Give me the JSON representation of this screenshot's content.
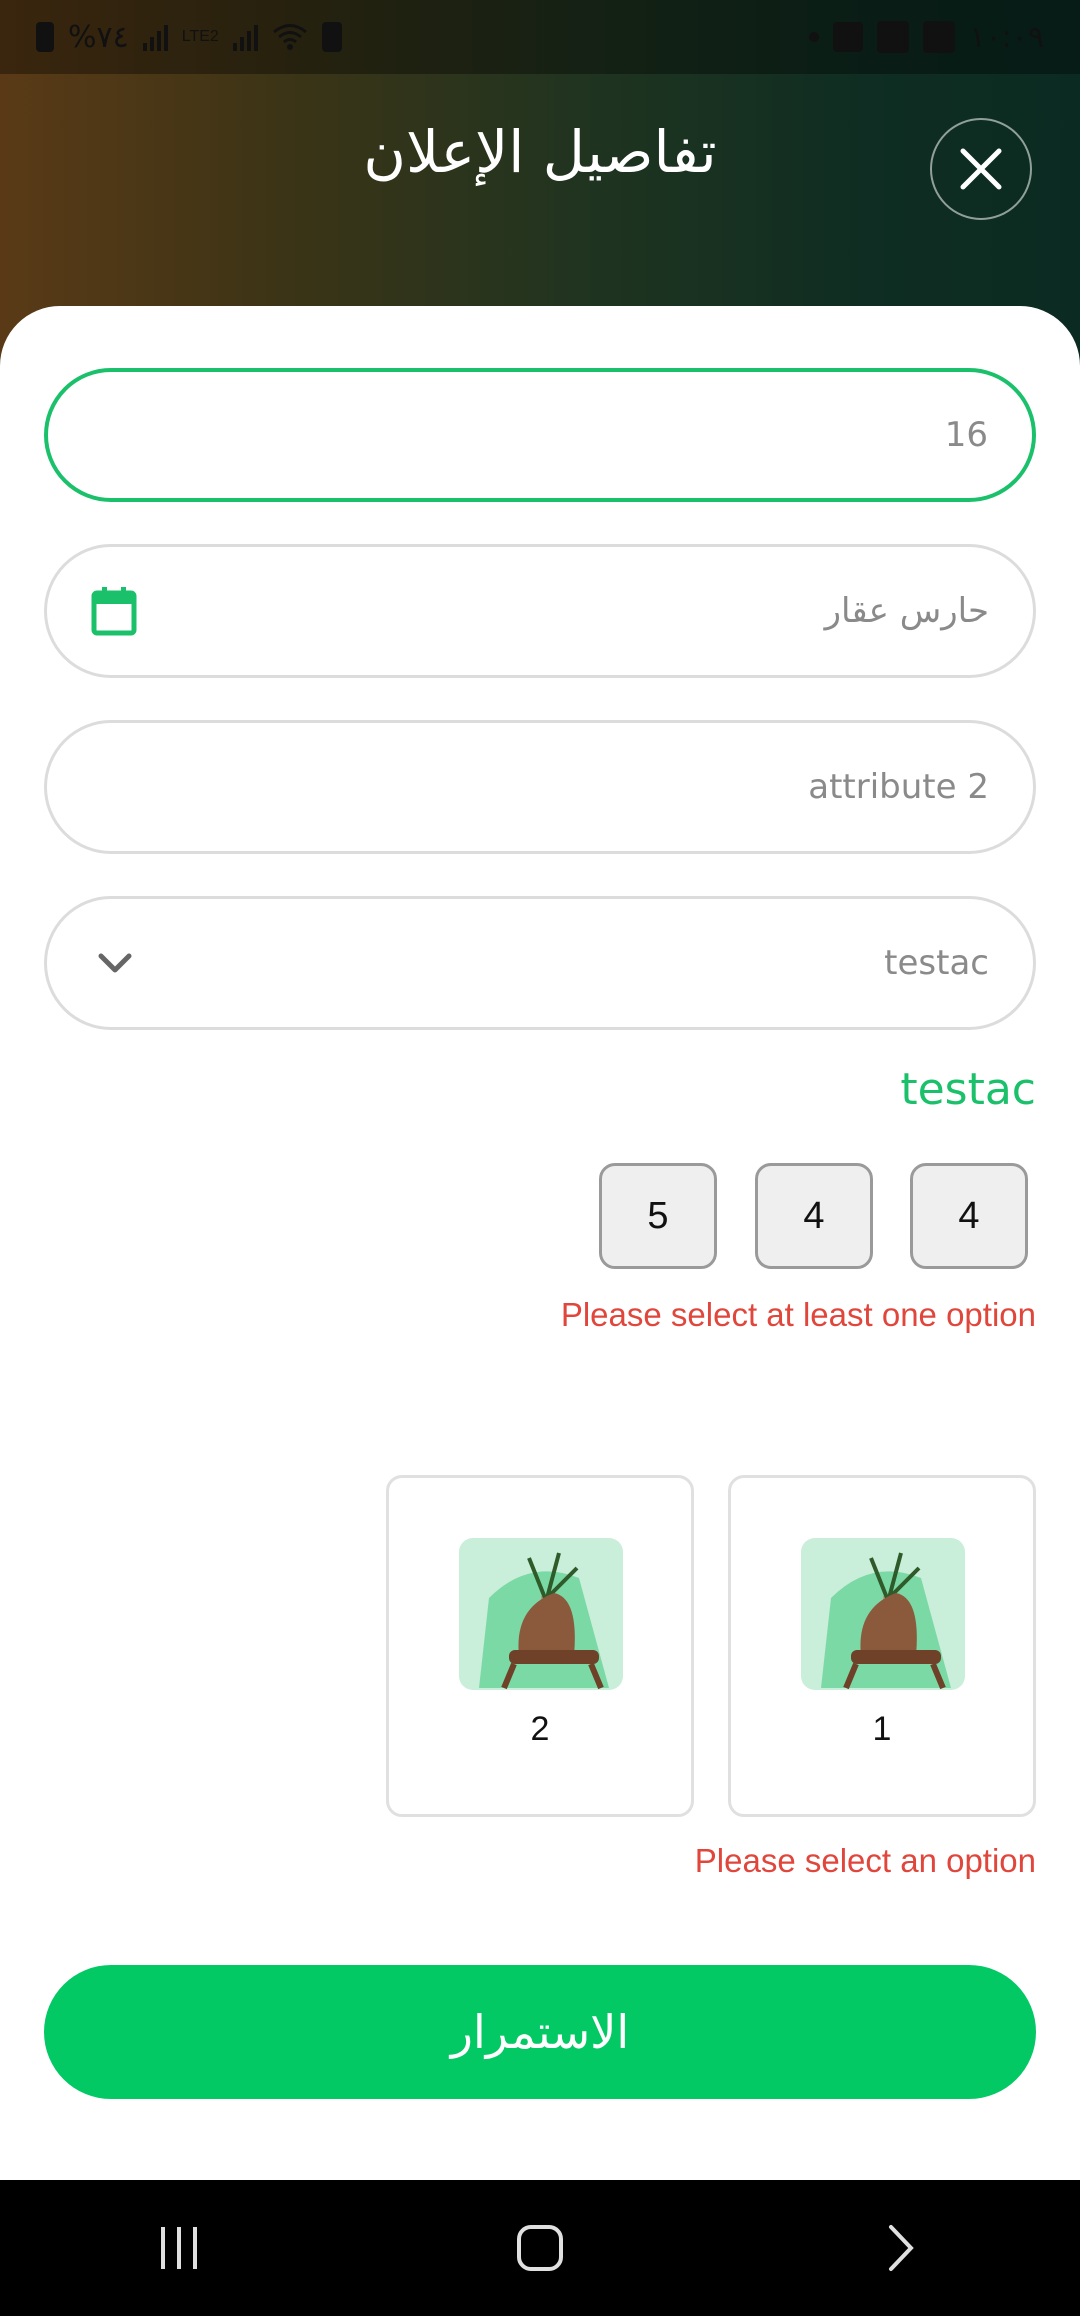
{
  "status_bar": {
    "battery_text": "%٧٤",
    "network_label": "LTE2",
    "time": "١٠:٠٩"
  },
  "header": {
    "title": "تفاصيل الإعلان"
  },
  "form": {
    "field1_value": "16",
    "field2_placeholder": "حارس عقار",
    "field3_placeholder": "attribute 2",
    "field4_selected": "testac"
  },
  "multi_select": {
    "label": "testac",
    "options": [
      "4",
      "4",
      "5"
    ],
    "error": "Please select at least one option"
  },
  "image_select": {
    "options": [
      "1",
      "2"
    ],
    "error": "Please select an option"
  },
  "continue_label": "الاستمرار",
  "colors": {
    "accent": "#02c964",
    "error": "#e0463b"
  }
}
